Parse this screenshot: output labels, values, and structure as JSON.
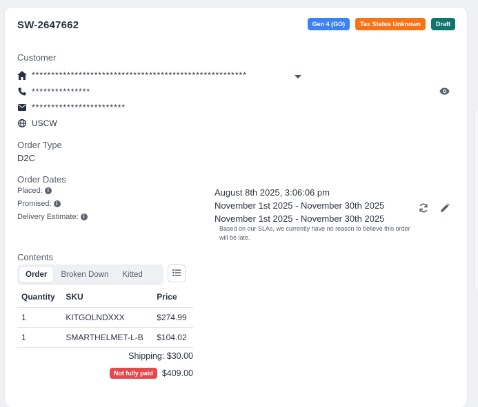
{
  "order": {
    "id": "SW-2647662",
    "badges": [
      {
        "label": "Gen 4 (GO)",
        "color": "#3b82f6"
      },
      {
        "label": "Tax Status Unknown",
        "color": "#f97316"
      },
      {
        "label": "Draft",
        "color": "#0f766e"
      }
    ]
  },
  "customer": {
    "label": "Customer",
    "address": "*******************************************************",
    "phone": "***************",
    "email": "************************",
    "region": "USCW"
  },
  "order_type": {
    "label": "Order Type",
    "value": "D2C"
  },
  "order_dates": {
    "label": "Order Dates",
    "placed_label": "Placed:",
    "promised_label": "Promised:",
    "delivery_label": "Delivery Estimate:",
    "placed_value": "August 8th 2025, 3:06:06 pm",
    "promised_value": "November 1st 2025 - November 30th 2025",
    "delivery_value": "November 1st 2025 - November 30th 2025",
    "sla_note": "Based on our SLAs, we currently have no reason to believe this order will be late."
  },
  "contents": {
    "label": "Contents",
    "tabs": [
      "Order",
      "Broken Down",
      "Kitted"
    ],
    "columns": [
      "Quantity",
      "SKU",
      "Price"
    ],
    "rows": [
      {
        "quantity": "1",
        "sku": "KITGOLNDXXX",
        "price": "$274.99"
      },
      {
        "quantity": "1",
        "sku": "SMARTHELMET-L-B",
        "price": "$104.02"
      }
    ],
    "shipping": "Shipping: $30.00",
    "payment_badge": "Not fully paid",
    "total": "$409.00"
  },
  "icons": {
    "address": "home-icon",
    "phone": "phone-icon",
    "email": "mail-icon",
    "region": "globe-icon",
    "reveal": "eye-icon",
    "refresh": "refresh-icon",
    "edit": "pencil-icon",
    "view_toggle": "list-icon"
  }
}
